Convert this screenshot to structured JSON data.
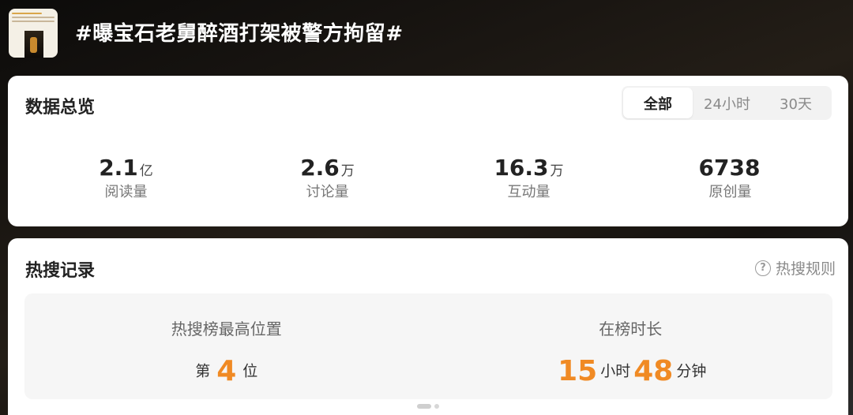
{
  "header": {
    "title": "#曝宝石老舅醉酒打架被警方拘留#",
    "thumbnail_icon": "topic-thumbnail"
  },
  "overview": {
    "title": "数据总览",
    "tabs": [
      {
        "label": "全部",
        "selected": true
      },
      {
        "label": "24小时",
        "selected": false
      },
      {
        "label": "30天",
        "selected": false
      }
    ],
    "stats": [
      {
        "value": "2.1",
        "unit": "亿",
        "label": "阅读量"
      },
      {
        "value": "2.6",
        "unit": "万",
        "label": "讨论量"
      },
      {
        "value": "16.3",
        "unit": "万",
        "label": "互动量"
      },
      {
        "value": "6738",
        "unit": "",
        "label": "原创量"
      }
    ]
  },
  "hot": {
    "title": "热搜记录",
    "rules_label": "热搜规则",
    "rules_icon": "question-circle-icon",
    "highest": {
      "label": "热搜榜最高位置",
      "prefix": "第",
      "rank": "4",
      "suffix": "位"
    },
    "duration": {
      "label": "在榜时长",
      "hours": "15",
      "hours_unit": "小时",
      "minutes": "48",
      "minutes_unit": "分钟"
    }
  },
  "colors": {
    "accent": "#f08a24",
    "card_bg": "#ffffff",
    "panel_bg": "#f6f6f6"
  }
}
